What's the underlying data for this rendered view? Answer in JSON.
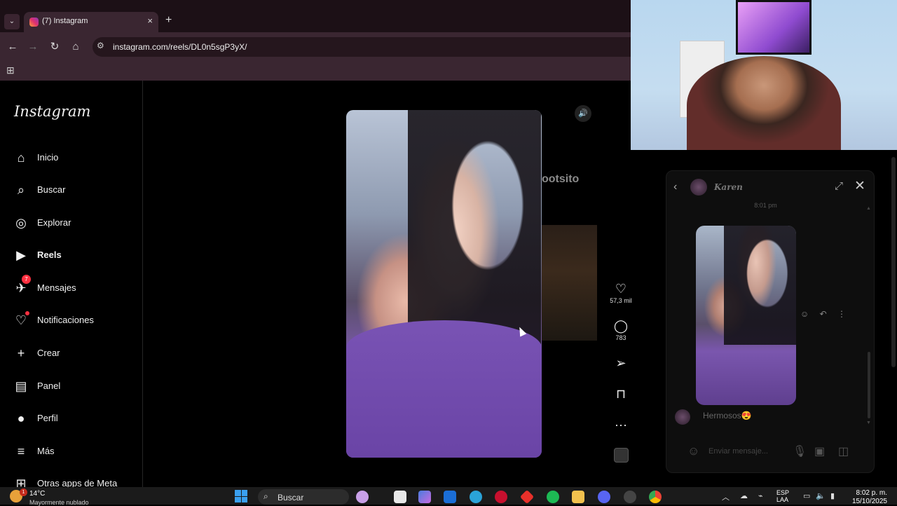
{
  "browser": {
    "tab_title": "(7) Instagram",
    "tab_close": "×",
    "new_tab": "+",
    "url": "instagram.com/reels/DL0n5sgP3yX/",
    "icons": {
      "back": "←",
      "forward": "→",
      "reload": "↻",
      "home": "⌂",
      "tune": "⚙",
      "apps": "⊞",
      "tab_menu": "⌄"
    }
  },
  "sidebar": {
    "logo": "Instagram",
    "items": [
      {
        "icon": "⌂",
        "label": "Inicio"
      },
      {
        "icon": "⌕",
        "label": "Buscar"
      },
      {
        "icon": "◎",
        "label": "Explorar"
      },
      {
        "icon": "▶",
        "label": "Reels"
      },
      {
        "icon": "✈",
        "label": "Mensajes",
        "badge": "7"
      },
      {
        "icon": "♡",
        "label": "Notificaciones"
      },
      {
        "icon": "+",
        "label": "Crear"
      },
      {
        "icon": "▤",
        "label": "Panel"
      },
      {
        "icon": "●",
        "label": "Perfil"
      },
      {
        "icon": "≡",
        "label": "Más"
      },
      {
        "icon": "⊞",
        "label": "Otras apps de Meta"
      }
    ]
  },
  "reel": {
    "next_title_fragment": "ootsito",
    "mute_icon": "🔊",
    "actions": {
      "like_icon": "♡",
      "like_count": "57,3 mil",
      "comment_icon": "◯",
      "comment_count": "783",
      "share_icon": "➢",
      "save_icon": "⊓",
      "more_icon": "···"
    }
  },
  "chat": {
    "back_icon": "‹",
    "name": "Karen",
    "expand_icon": "⤢",
    "close_icon": "✕",
    "time": "8:01 pm",
    "react_icons": "☺ ↶ ⋮",
    "message": "Hermosos😍",
    "input_placeholder": "Enviar mensaje...",
    "emoji_icon": "☺",
    "mic_icon": "🎙",
    "gallery_icon": "▣",
    "sticker_icon": "◫",
    "scroll_up": "▲",
    "scroll_down": "▼"
  },
  "taskbar": {
    "weather_badge": "1",
    "temperature": "14°C",
    "condition": "Mayormente nublado",
    "search_label": "Buscar",
    "search_icon": "⌕",
    "tray_chevron": "︿",
    "language": "ESP",
    "language_sub": "LAA",
    "time": "8:02 p. m.",
    "date": "15/10/2025",
    "app_colors": [
      "#c9a0e8",
      "#e8e8e8",
      "#4a7de0",
      "#1b6ed6",
      "#2aa3d8",
      "#c8102e",
      "#e8302a",
      "#1db954",
      "#f2c14e",
      "#5865f2",
      "#e03a3a",
      "#4285f4"
    ]
  }
}
